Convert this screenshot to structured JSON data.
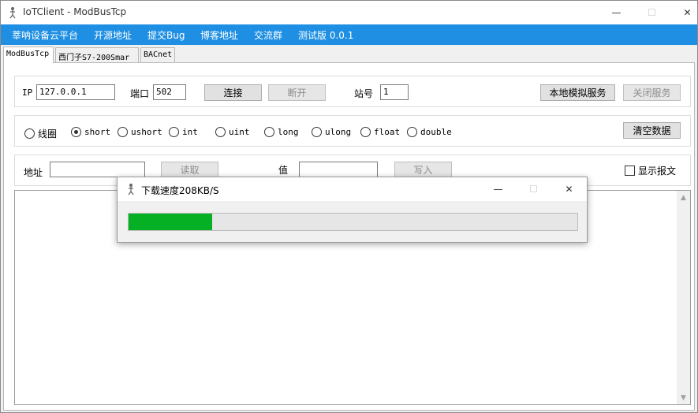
{
  "window": {
    "title": "IoTClient - ModBusTcp",
    "min_glyph": "—",
    "max_glyph": "☐",
    "close_glyph": "✕"
  },
  "menu": [
    "莘呐设备云平台",
    "开源地址",
    "提交Bug",
    "博客地址",
    "交流群",
    "测试版 0.0.1"
  ],
  "tabs": [
    "ModBusTcp",
    "西门子S7-200Smar",
    "BACnet"
  ],
  "connection": {
    "ip_label": "IP",
    "ip_value": "127.0.0.1",
    "port_label": "端口",
    "port_value": "502",
    "connect_button": "连接",
    "disconnect_button": "断开",
    "station_label": "站号",
    "station_value": "1",
    "local_sim_button": "本地模拟服务",
    "close_service_button": "关闭服务"
  },
  "datatypes": {
    "options": [
      "线圈",
      "short",
      "ushort",
      "int",
      "uint",
      "long",
      "ulong",
      "float",
      "double"
    ],
    "selected": "short",
    "clear_button": "清空数据"
  },
  "readwrite": {
    "address_label": "地址",
    "address_value": "",
    "read_button": "读取",
    "value_label": "值",
    "value_value": "",
    "write_button": "写入",
    "show_packets_label": "显示报文",
    "show_packets_checked": false
  },
  "output": {
    "text": "",
    "scroll_up": "▲",
    "scroll_down": "▼"
  },
  "dialog": {
    "title": "下载速度208KB/S",
    "progress": 0.187,
    "min_glyph": "—",
    "max_glyph": "☐",
    "close_glyph": "✕"
  },
  "colors": {
    "menubar": "#1e8fe3",
    "progress_fill": "#06b025"
  }
}
